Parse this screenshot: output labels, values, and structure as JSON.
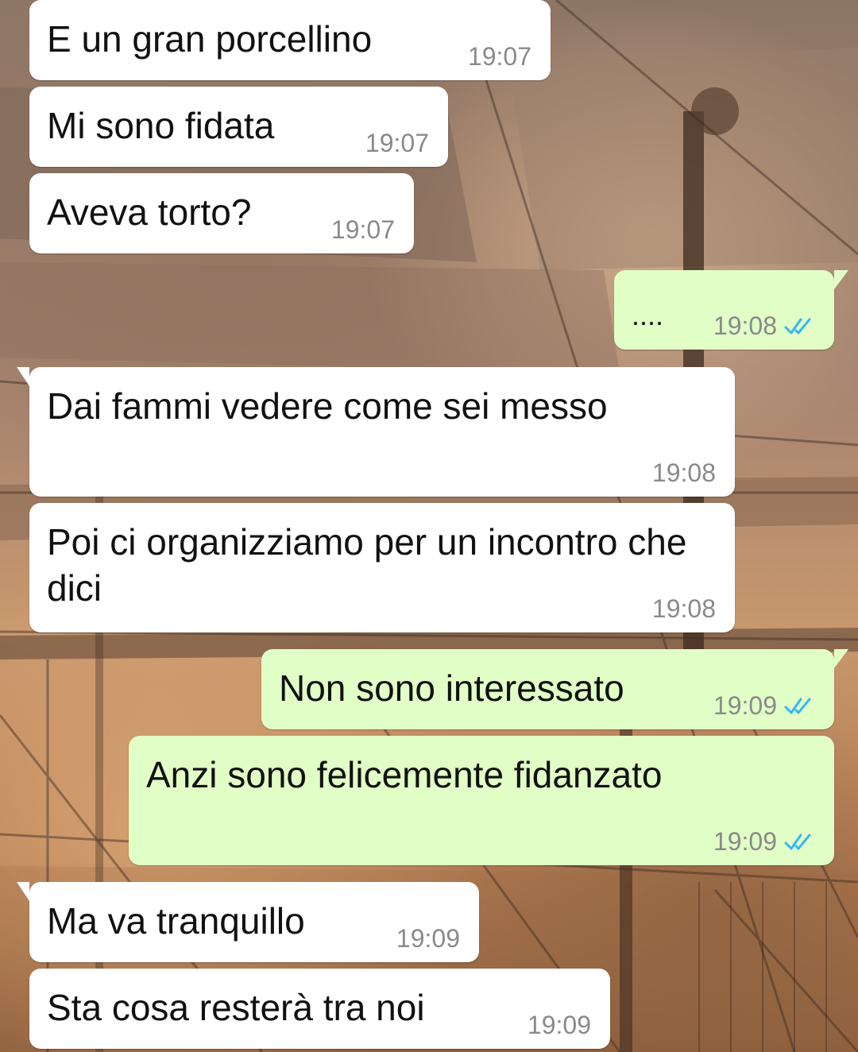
{
  "colors": {
    "incoming_bubble": "#ffffff",
    "outgoing_bubble": "#e1fec6",
    "time_text": "#8a8a8a",
    "read_check": "#34b7f1"
  },
  "messages": [
    {
      "text": "E un gran porcellino",
      "time": "19:07",
      "direction": "incoming"
    },
    {
      "text": "Mi sono fidata",
      "time": "19:07",
      "direction": "incoming"
    },
    {
      "text": "Aveva torto?",
      "time": "19:07",
      "direction": "incoming"
    },
    {
      "text": "....",
      "time": "19:08",
      "direction": "outgoing",
      "status_icon": "double-check-icon"
    },
    {
      "text": "Dai fammi vedere come sei messo",
      "time": "19:08",
      "direction": "incoming"
    },
    {
      "text": "Poi ci organizziamo per un incontro che dici",
      "time": "19:08",
      "direction": "incoming"
    },
    {
      "text": "Non sono interessato",
      "time": "19:09",
      "direction": "outgoing",
      "status_icon": "double-check-icon"
    },
    {
      "text": "Anzi sono felicemente fidanzato",
      "time": "19:09",
      "direction": "outgoing",
      "status_icon": "double-check-icon"
    },
    {
      "text": "Ma va tranquillo",
      "time": "19:09",
      "direction": "incoming"
    },
    {
      "text": "Sta cosa resterà tra noi",
      "time": "19:09",
      "direction": "incoming"
    }
  ]
}
